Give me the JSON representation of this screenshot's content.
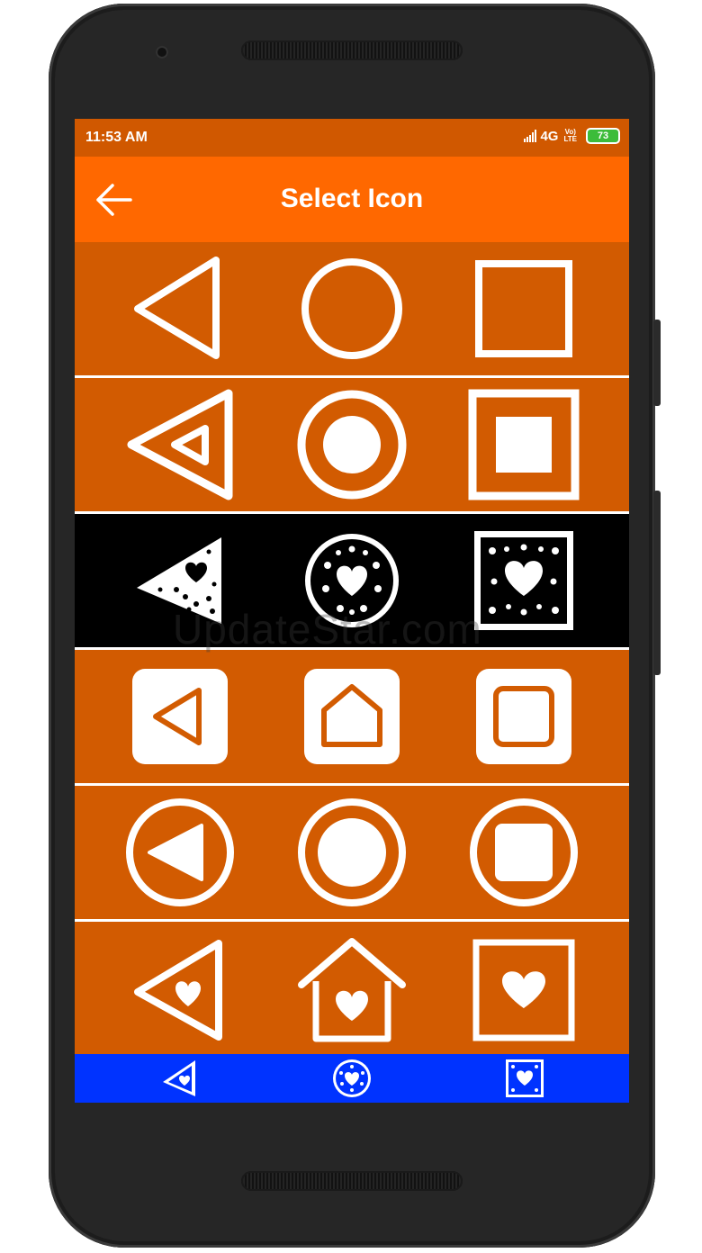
{
  "status_bar": {
    "time": "11:53 AM",
    "network": "4G",
    "volte_top": "Vo)",
    "volte_bottom": "LTE",
    "battery": "73"
  },
  "app_bar": {
    "title": "Select Icon"
  },
  "colors": {
    "status_bar": "#D05800",
    "app_bar": "#FF6800",
    "row_background": "#D25B01",
    "dark_row": "#000000",
    "bottom_bar": "#0033FF",
    "icon": "#FFFFFF",
    "battery": "#3CBC3A"
  },
  "icon_rows": [
    [
      "triangle-outline-icon",
      "circle-outline-icon",
      "square-outline-icon"
    ],
    [
      "triangle-double-outline-icon",
      "circle-ring-dot-icon",
      "square-frame-filled-icon"
    ],
    [
      "triangle-hearts-icon",
      "circle-hearts-icon",
      "square-hearts-icon"
    ],
    [
      "rounded-square-triangle-icon",
      "rounded-square-house-icon",
      "rounded-square-square-icon"
    ],
    [
      "circle-ring-triangle-icon",
      "circle-ring-circle-icon",
      "circle-ring-square-icon"
    ],
    [
      "triangle-heart-icon",
      "house-heart-icon",
      "square-heart-icon"
    ]
  ],
  "bottom_bar": [
    "triangle-hearts-icon",
    "circle-hearts-icon",
    "square-hearts-icon"
  ],
  "watermark": "UpdateStar.com"
}
